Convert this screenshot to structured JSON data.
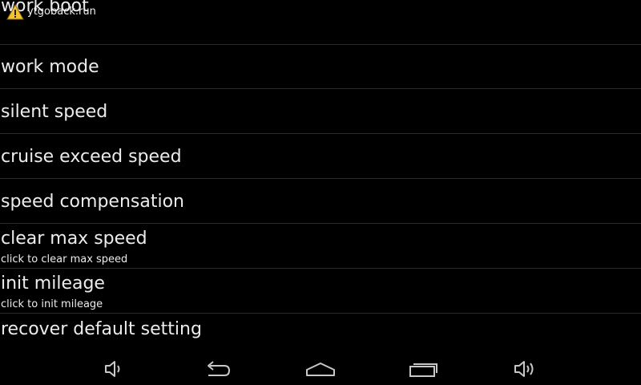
{
  "notification": {
    "app_name": "ytgoback.run",
    "icon": "warning-icon"
  },
  "settings": {
    "items": [
      {
        "title": "work boot",
        "summary": ""
      },
      {
        "title": "work mode",
        "summary": ""
      },
      {
        "title": "silent speed",
        "summary": ""
      },
      {
        "title": "cruise exceed speed",
        "summary": ""
      },
      {
        "title": "speed compensation",
        "summary": ""
      },
      {
        "title": "clear max speed",
        "summary": "click to clear max speed"
      },
      {
        "title": "init mileage",
        "summary": "click to init mileage"
      },
      {
        "title": "recover default setting",
        "summary": ""
      }
    ]
  },
  "navbar": {
    "buttons": [
      {
        "icon": "volume-down-icon"
      },
      {
        "icon": "back-icon"
      },
      {
        "icon": "home-icon"
      },
      {
        "icon": "recent-apps-icon"
      },
      {
        "icon": "volume-up-icon"
      }
    ]
  },
  "colors": {
    "background": "#000000",
    "text": "#ececec",
    "divider": "#2b2b2b",
    "nav_icon": "#c8c8c8"
  }
}
